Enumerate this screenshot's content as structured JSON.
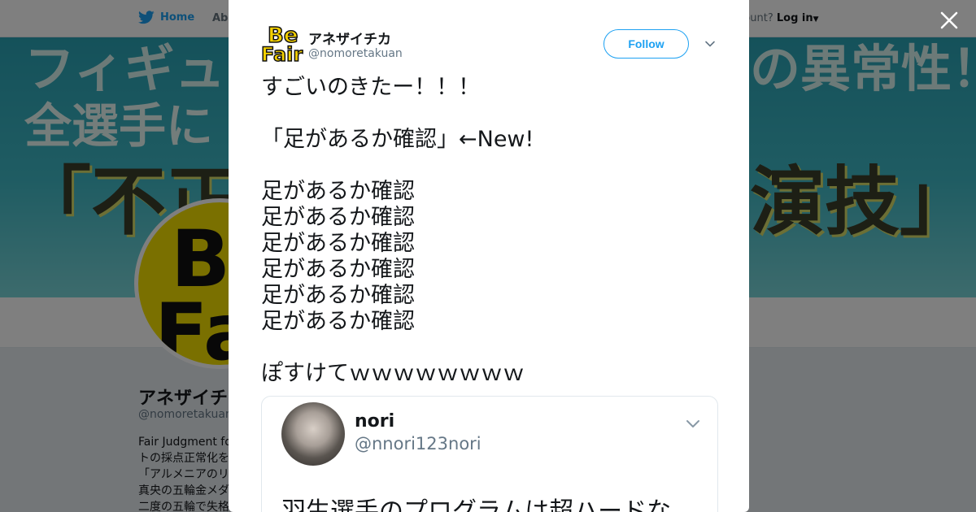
{
  "nav": {
    "home_label": "Home",
    "about_label": "Abo",
    "account_prompt": "ccount?",
    "login_label": "Log in"
  },
  "banner": {
    "left_line1": "フィギュ",
    "left_line2": "全選手に",
    "left_line3": "「不正の",
    "right_line1": "の異常性！",
    "right_line3": "演技」"
  },
  "background_profile": {
    "avatar_text1": "Be",
    "avatar_text2": "Fa",
    "name": "アネザイチ",
    "handle": "@nomoretakuan",
    "bio_lines": [
      "Fair Judgment for",
      "トの採点正常化を",
      "「アルメニアのリ",
      "真央の五輪金メダ",
      "二度の五輪で失格"
    ]
  },
  "modal": {
    "avatar_text1": "Be",
    "avatar_text2": "Fair",
    "author_name": "アネザイチカ",
    "author_handle": "@nomoretakuan",
    "follow_label": "Follow",
    "tweet_lines": [
      "すごいのきたー！！！",
      "",
      "「足があるか確認」←New!",
      "",
      "足があるか確認",
      "足があるか確認",
      "足があるか確認",
      "足があるか確認",
      "足があるか確認",
      "足があるか確認",
      "",
      "ぽすけてｗｗｗｗｗｗｗｗ"
    ],
    "quote": {
      "name": "nori",
      "handle": "@nnori123nori",
      "text": "羽生選手のプログラムは超ハードな"
    }
  },
  "colors": {
    "twitter_blue": "#1da1f2",
    "overlay": "rgba(0,0,0,0.5)",
    "secondary_text": "#657786"
  },
  "icons": [
    "twitter-bird-icon",
    "close-icon",
    "chevron-down-icon"
  ]
}
